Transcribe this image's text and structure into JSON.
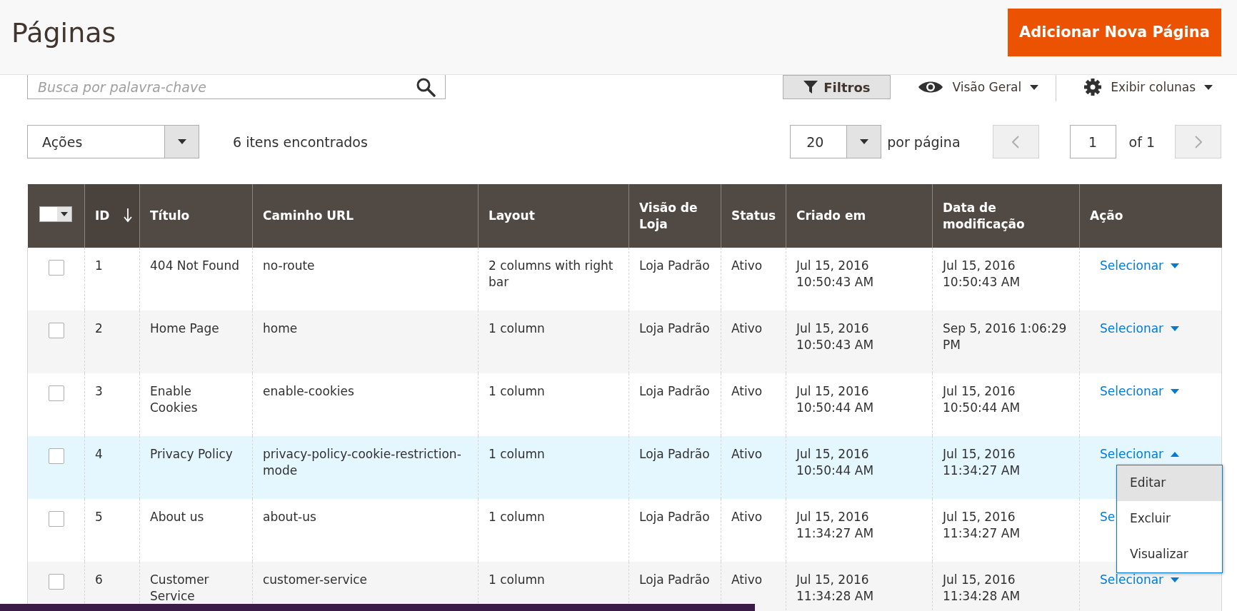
{
  "page_title": "Páginas",
  "add_button": "Adicionar Nova Página",
  "search": {
    "placeholder": "Busca por palavra-chave"
  },
  "toolbar": {
    "filters": "Filtros",
    "view": "Visão Geral",
    "columns": "Exibir colunas"
  },
  "actions_select": "Ações",
  "records_found": "6 itens encontrados",
  "per_page": {
    "value": "20",
    "label": "por página"
  },
  "pager": {
    "page": "1",
    "of": "of 1"
  },
  "select_all": {
    "checked": false
  },
  "columns": [
    {
      "label": "ID",
      "sorted": true
    },
    {
      "label": "Título",
      "sorted": false
    },
    {
      "label": "Caminho URL",
      "sorted": false
    },
    {
      "label": "Layout",
      "sorted": false
    },
    {
      "label": "Visão de Loja",
      "sorted": false
    },
    {
      "label": "Status",
      "sorted": false
    },
    {
      "label": "Criado em",
      "sorted": false
    },
    {
      "label": "Data de modificação",
      "sorted": false
    },
    {
      "label": "Ação",
      "sorted": false
    }
  ],
  "rows": [
    {
      "checked": false,
      "highlighted": false,
      "cells": [
        "1",
        "404 Not Found",
        "no-route",
        "2 columns with right bar",
        "Loja Padrão",
        "Ativo",
        "Jul 15, 2016 10:50:43 AM",
        "Jul 15, 2016 10:50:43 AM"
      ],
      "action": {
        "kind": "dropdown",
        "label": "Selecionar",
        "menu_open": false
      }
    },
    {
      "checked": false,
      "highlighted": false,
      "cells": [
        "2",
        "Home Page",
        "home",
        "1 column",
        "Loja Padrão",
        "Ativo",
        "Jul 15, 2016 10:50:43 AM",
        "Sep 5, 2016 1:06:29 PM"
      ],
      "action": {
        "kind": "dropdown",
        "label": "Selecionar",
        "menu_open": false
      }
    },
    {
      "checked": false,
      "highlighted": false,
      "cells": [
        "3",
        "Enable Cookies",
        "enable-cookies",
        "1 column",
        "Loja Padrão",
        "Ativo",
        "Jul 15, 2016 10:50:44 AM",
        "Jul 15, 2016 10:50:44 AM"
      ],
      "action": {
        "kind": "dropdown",
        "label": "Selecionar",
        "menu_open": false
      }
    },
    {
      "checked": false,
      "highlighted": true,
      "cells": [
        "4",
        "Privacy Policy",
        "privacy-policy-cookie-restriction-mode",
        "1 column",
        "Loja Padrão",
        "Ativo",
        "Jul 15, 2016 10:50:44 AM",
        "Jul 15, 2016 11:34:27 AM"
      ],
      "action": {
        "kind": "dropdown",
        "label": "Selecionar",
        "menu_open": true,
        "menu": [
          {
            "label": "Editar",
            "highlighted": true
          },
          {
            "label": "Excluir",
            "highlighted": false
          },
          {
            "label": "Visualizar",
            "highlighted": false
          }
        ]
      }
    },
    {
      "checked": false,
      "highlighted": false,
      "cells": [
        "5",
        "About us",
        "about-us",
        "1 column",
        "Loja Padrão",
        "Ativo",
        "Jul 15, 2016 11:34:27 AM",
        "Jul 15, 2016 11:34:27 AM"
      ],
      "action": {
        "kind": "clipped",
        "label": "Se"
      }
    },
    {
      "checked": false,
      "highlighted": false,
      "cells": [
        "6",
        "Customer Service",
        "customer-service",
        "1 column",
        "Loja Padrão",
        "Ativo",
        "Jul 15, 2016 11:34:28 AM",
        "Jul 15, 2016 11:34:28 AM"
      ],
      "action": {
        "kind": "dropdown",
        "label": "Selecionar",
        "menu_open": false
      }
    }
  ]
}
